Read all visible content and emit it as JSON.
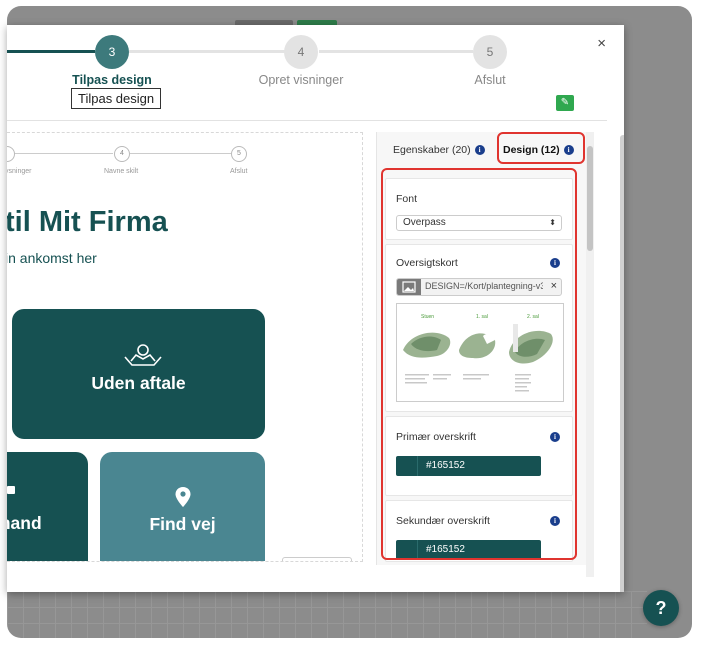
{
  "wizard": {
    "steps": [
      {
        "number": "3",
        "label": "Tilpas design",
        "state": "active"
      },
      {
        "number": "4",
        "label": "Opret visninger",
        "state": "inactive"
      },
      {
        "number": "5",
        "label": "Afslut",
        "state": "inactive"
      }
    ],
    "tooltip": "Tilpas design",
    "close_label": "×"
  },
  "preview": {
    "mini_steps": [
      {
        "number": "4",
        "label": "Navne skilt"
      },
      {
        "number": "5",
        "label": "Afslut"
      }
    ],
    "mini_first_label": "ysninger",
    "title": "til Mit Firma",
    "subtitle": "in ankomst her",
    "tiles": {
      "no_appointment": "Uden aftale",
      "employee": "mand",
      "find_way": "Find vej"
    }
  },
  "panel": {
    "tabs": [
      {
        "label": "Egenskaber (20)",
        "active": false
      },
      {
        "label": "Design (12)",
        "active": true
      }
    ],
    "font": {
      "title": "Font",
      "value": "Overpass"
    },
    "overview_map": {
      "title": "Oversigtskort",
      "file_value": "DESIGN=/Kort/plantegning-v3.",
      "floor_labels": [
        "Stuen",
        "1. sal",
        "2. sal"
      ]
    },
    "primary_heading": {
      "title": "Primær overskrift",
      "value": "#165152"
    },
    "secondary_heading": {
      "title": "Sekundær overskrift",
      "value": "#165152"
    }
  },
  "help_label": "?",
  "colors": {
    "brand": "#165152",
    "tile_light": "#4a8691",
    "highlight": "#e0342f",
    "info": "#1a3e8c"
  }
}
